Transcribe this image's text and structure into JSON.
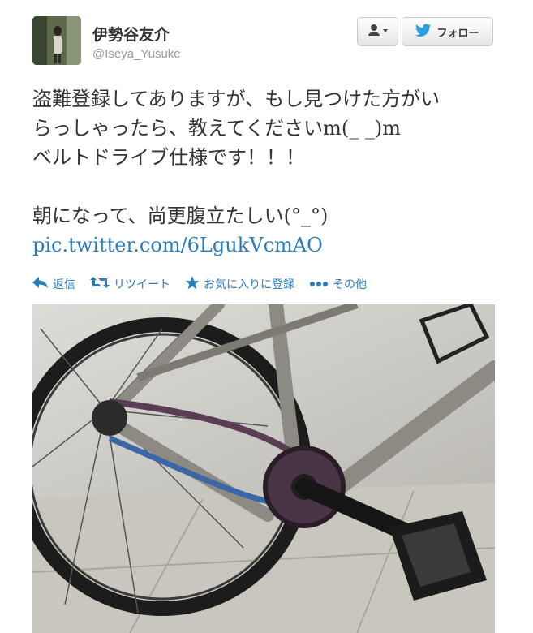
{
  "user": {
    "display_name": "伊勢谷友介",
    "screen_name": "@Iseya_Yusuke"
  },
  "buttons": {
    "user_menu_icon": "user-dropdown-icon",
    "follow_label": "フォロー"
  },
  "tweet": {
    "lines": [
      "盗難登録してありますが、もし見つけた方がい",
      "らっしゃったら、教えてくださいm(_ _)m",
      "ベルトドライブ仕様です！！！",
      "",
      "朝になって、尚更腹立たしい(°_°)"
    ],
    "link": "pic.twitter.com/6LgukVcmAO"
  },
  "actions": {
    "reply": "返信",
    "retweet": "リツイート",
    "favorite": "お気に入りに登録",
    "more": "その他"
  },
  "colors": {
    "link": "#2b7bb9",
    "text": "#333333",
    "muted": "#999999"
  }
}
